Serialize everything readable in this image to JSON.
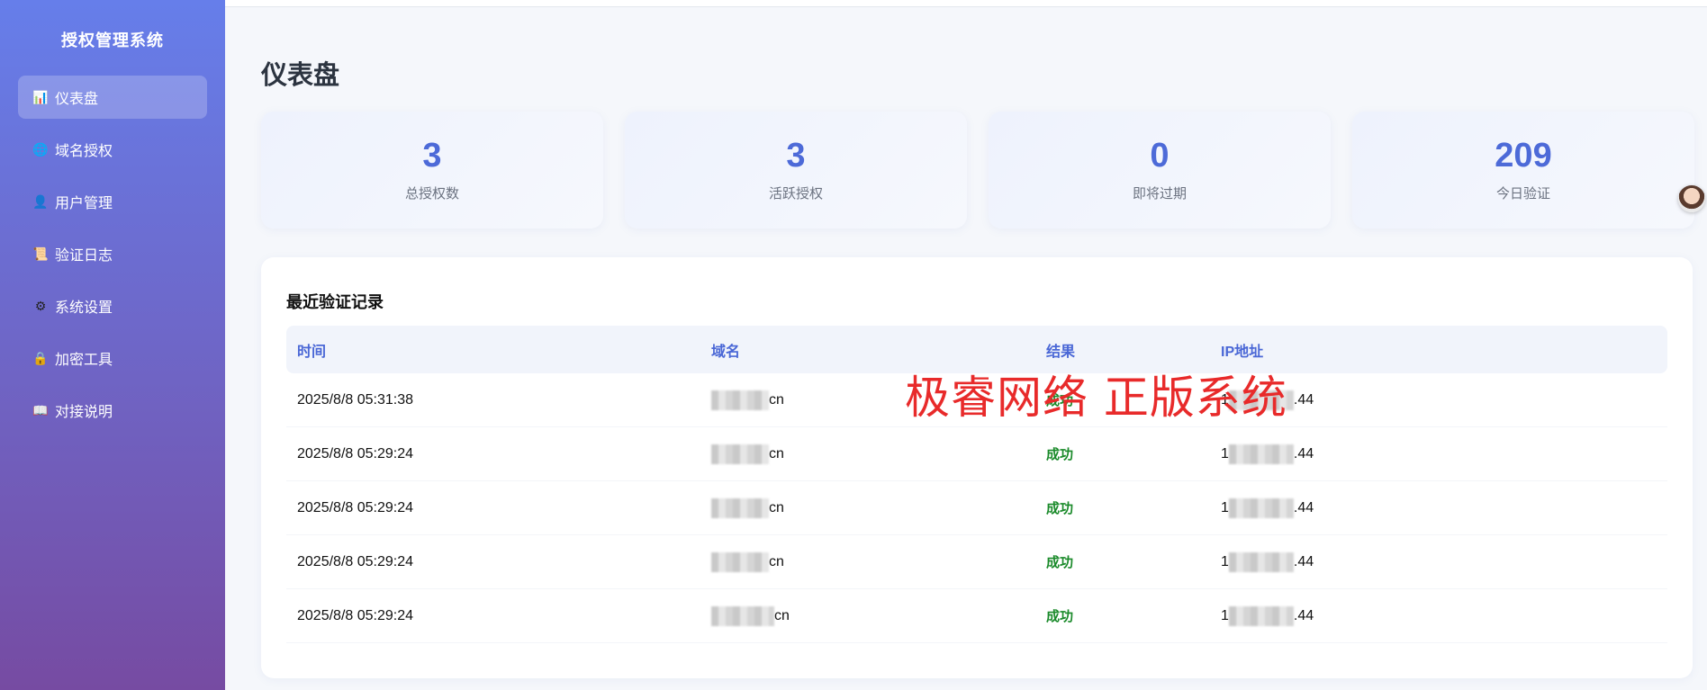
{
  "sidebar": {
    "brand": "授权管理系统",
    "items": [
      {
        "label": "仪表盘",
        "icon": "bar-chart-icon",
        "glyph": "📊",
        "active": true
      },
      {
        "label": "域名授权",
        "icon": "globe-icon",
        "glyph": "🌐"
      },
      {
        "label": "用户管理",
        "icon": "user-icon",
        "glyph": "👤"
      },
      {
        "label": "验证日志",
        "icon": "scroll-icon",
        "glyph": "📜"
      },
      {
        "label": "系统设置",
        "icon": "gear-icon",
        "glyph": "⚙"
      },
      {
        "label": "加密工具",
        "icon": "lock-icon",
        "glyph": "🔒"
      },
      {
        "label": "对接说明",
        "icon": "book-icon",
        "glyph": "📖"
      }
    ]
  },
  "main": {
    "title": "仪表盘",
    "stats": [
      {
        "value": "3",
        "label": "总授权数"
      },
      {
        "value": "3",
        "label": "活跃授权"
      },
      {
        "value": "0",
        "label": "即将过期"
      },
      {
        "value": "209",
        "label": "今日验证"
      }
    ],
    "records": {
      "title": "最近验证记录",
      "columns": [
        "时间",
        "域名",
        "结果",
        "IP地址"
      ],
      "rows": [
        {
          "time": "2025/8/8 05:31:38",
          "domain_suffix": "cn",
          "result": "成功",
          "ip_prefix": "1",
          "ip_suffix": ".44"
        },
        {
          "time": "2025/8/8 05:29:24",
          "domain_suffix": "cn",
          "result": "成功",
          "ip_prefix": "1",
          "ip_suffix": ".44"
        },
        {
          "time": "2025/8/8 05:29:24",
          "domain_suffix": "cn",
          "result": "成功",
          "ip_prefix": "1",
          "ip_suffix": ".44"
        },
        {
          "time": "2025/8/8 05:29:24",
          "domain_suffix": "cn",
          "result": "成功",
          "ip_prefix": "1",
          "ip_suffix": ".44"
        },
        {
          "time": "2025/8/8 05:29:24",
          "domain_suffix": "cn",
          "result": "成功",
          "ip_prefix": "1",
          "ip_suffix": ".44"
        }
      ]
    }
  },
  "watermark": "极睿网络 正版系统",
  "colors": {
    "accent": "#4d6ad8",
    "success": "#1a8a2a",
    "sidebar_top": "#667eea",
    "sidebar_bottom": "#764ba2",
    "watermark": "#e82a2a"
  }
}
